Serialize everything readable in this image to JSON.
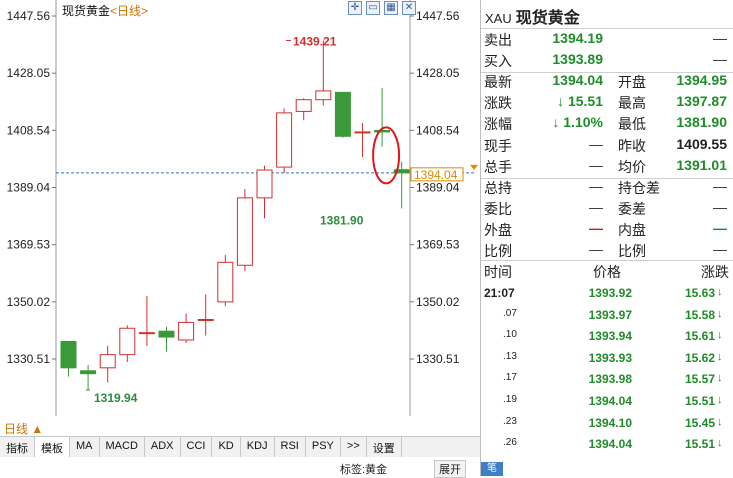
{
  "chart_header": {
    "instrument": "现货黄金",
    "period": "<日线>",
    "period_tab": "日线 ▲"
  },
  "toolbar_icons": [
    "expand-icon",
    "window-icon",
    "chart-icon",
    "close-icon"
  ],
  "chart_data": {
    "type": "candlestick",
    "ylim": [
      1310,
      1450
    ],
    "yticks": [
      "1447.56",
      "1428.05",
      "1408.54",
      "1389.04",
      "1369.53",
      "1350.02",
      "1330.51"
    ],
    "ytick_values": [
      1447.56,
      1428.05,
      1408.54,
      1389.04,
      1369.53,
      1350.02,
      1330.51
    ],
    "current_price_label": "1394.04",
    "current_price": 1394.04,
    "annotations": [
      {
        "text": "1439.21",
        "value": 1439.21,
        "color": "#d03030"
      },
      {
        "text": "1381.90",
        "value": 1381.9,
        "color": "#2e8b3a"
      },
      {
        "text": "1319.94",
        "value": 1319.94,
        "color": "#2e8b3a"
      }
    ],
    "candles": [
      {
        "o": 1336.5,
        "h": 1336.5,
        "l": 1324.5,
        "c": 1327.5
      },
      {
        "o": 1326.5,
        "h": 1328.5,
        "l": 1319.94,
        "c": 1325.5
      },
      {
        "o": 1327.5,
        "h": 1335.0,
        "l": 1322.5,
        "c": 1332.0
      },
      {
        "o": 1332.0,
        "h": 1342.0,
        "l": 1329.5,
        "c": 1341.0
      },
      {
        "o": 1339.5,
        "h": 1352.0,
        "l": 1335.0,
        "c": 1339.5
      },
      {
        "o": 1340.0,
        "h": 1341.5,
        "l": 1333.0,
        "c": 1338.0
      },
      {
        "o": 1337.0,
        "h": 1346.0,
        "l": 1336.0,
        "c": 1343.0
      },
      {
        "o": 1344.0,
        "h": 1352.5,
        "l": 1338.5,
        "c": 1344.0
      },
      {
        "o": 1350.0,
        "h": 1366.0,
        "l": 1348.5,
        "c": 1363.5
      },
      {
        "o": 1362.5,
        "h": 1388.5,
        "l": 1360.5,
        "c": 1385.5
      },
      {
        "o": 1385.5,
        "h": 1396.5,
        "l": 1378.5,
        "c": 1395.0
      },
      {
        "o": 1396.0,
        "h": 1416.0,
        "l": 1394.0,
        "c": 1414.5
      },
      {
        "o": 1415.0,
        "h": 1419.5,
        "l": 1412.0,
        "c": 1419.0
      },
      {
        "o": 1419.0,
        "h": 1439.21,
        "l": 1417.0,
        "c": 1422.0
      },
      {
        "o": 1421.5,
        "h": 1421.5,
        "l": 1406.0,
        "c": 1406.5
      },
      {
        "o": 1408.0,
        "h": 1411.0,
        "l": 1399.5,
        "c": 1408.0
      },
      {
        "o": 1408.5,
        "h": 1423.0,
        "l": 1403.0,
        "c": 1408.0
      },
      {
        "o": 1394.95,
        "h": 1397.87,
        "l": 1381.9,
        "c": 1394.04
      }
    ],
    "highlight_ellipse_on_candle_index": 16,
    "colors": {
      "up": "#d03030",
      "down": "#3a9a3a",
      "grid": "#2d6fc0"
    }
  },
  "indicator_tabs": [
    "指标",
    "模板",
    "MA",
    "MACD",
    "ADX",
    "CCI",
    "KD",
    "KDJ",
    "RSI",
    "PSY",
    ">>",
    "设置"
  ],
  "status_bar": {
    "label": "标签:黄金",
    "button": "展开"
  },
  "panel": {
    "code": "XAU",
    "name": "现货黄金",
    "rows": [
      {
        "l1": "卖出",
        "v1": "1394.19",
        "c1": "green",
        "l2": "",
        "v2": "—",
        "c2": "dash"
      },
      {
        "l1": "买入",
        "v1": "1393.89",
        "c1": "green",
        "l2": "",
        "v2": "—",
        "c2": "dash"
      },
      {
        "l1": "最新",
        "v1": "1394.04",
        "c1": "green",
        "l2": "开盘",
        "v2": "1394.95",
        "c2": "green"
      },
      {
        "l1": "涨跌",
        "v1": "↓ 15.51",
        "c1": "green",
        "l2": "最高",
        "v2": "1397.87",
        "c2": "green"
      },
      {
        "l1": "涨幅",
        "v1": "↓ 1.10%",
        "c1": "green",
        "l2": "最低",
        "v2": "1381.90",
        "c2": "green"
      },
      {
        "l1": "现手",
        "v1": "—",
        "c1": "dash",
        "l2": "昨收",
        "v2": "1409.55",
        "c2": "bold"
      },
      {
        "l1": "总手",
        "v1": "—",
        "c1": "dash",
        "l2": "均价",
        "v2": "1391.01",
        "c2": "green"
      },
      {
        "l1": "总持",
        "v1": "—",
        "c1": "dash",
        "l2": "持仓差",
        "v2": "—",
        "c2": "dash"
      },
      {
        "l1": "委比",
        "v1": "—",
        "c1": "dash",
        "l2": "委差",
        "v2": "—",
        "c2": "dash"
      },
      {
        "l1": "外盘",
        "v1": "—",
        "c1": "red",
        "l2": "内盘",
        "v2": "—",
        "c2": "green"
      },
      {
        "l1": "比例",
        "v1": "—",
        "c1": "dash",
        "l2": "比例",
        "v2": "—",
        "c2": "dash"
      }
    ],
    "table_headers": [
      "时间",
      "价格",
      "涨跌"
    ],
    "ticks": [
      {
        "t": "21:07",
        "p": "1393.92",
        "c": "15.63"
      },
      {
        "t": ".07",
        "p": "1393.97",
        "c": "15.58"
      },
      {
        "t": ".10",
        "p": "1393.94",
        "c": "15.61"
      },
      {
        "t": ".13",
        "p": "1393.93",
        "c": "15.62"
      },
      {
        "t": ".17",
        "p": "1393.98",
        "c": "15.57"
      },
      {
        "t": ".19",
        "p": "1394.04",
        "c": "15.51"
      },
      {
        "t": ".23",
        "p": "1394.10",
        "c": "15.45"
      },
      {
        "t": ".26",
        "p": "1394.04",
        "c": "15.51"
      }
    ],
    "arrow": "↓",
    "side_tab": "笔"
  }
}
